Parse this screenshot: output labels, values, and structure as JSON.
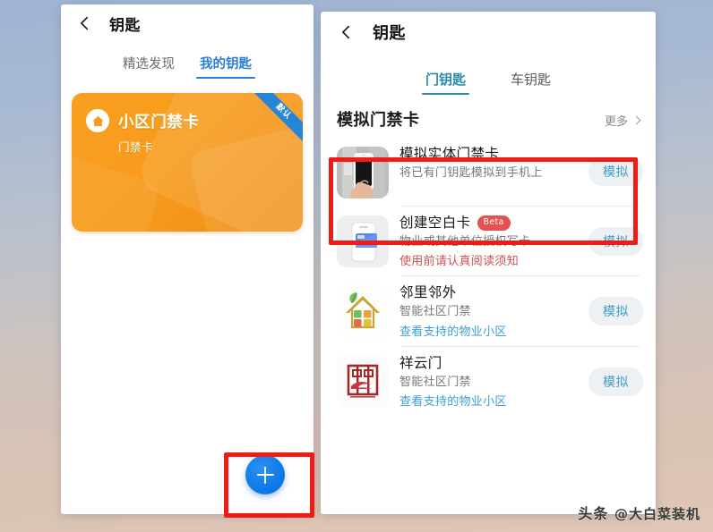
{
  "left_phone": {
    "appbar": {
      "title": "钥匙",
      "back_icon": "back-arrow-icon"
    },
    "tabs": [
      {
        "label": "精选发现",
        "active": false
      },
      {
        "label": "我的钥匙",
        "active": true
      }
    ],
    "card": {
      "title": "小区门禁卡",
      "subtitle": "门禁卡",
      "ribbon_label": "默认",
      "icon": "home-icon",
      "accent": "#f79b1d",
      "ribbon_color": "#2487d6"
    },
    "fab": {
      "icon": "plus-icon",
      "color": "#0d7ae6"
    }
  },
  "right_phone": {
    "appbar": {
      "title": "钥匙",
      "back_icon": "back-arrow-icon"
    },
    "tabs": [
      {
        "label": "门钥匙",
        "active": true
      },
      {
        "label": "车钥匙",
        "active": false
      }
    ],
    "section": {
      "title": "模拟门禁卡",
      "more_label": "更多",
      "more_icon": "chevron-right-icon"
    },
    "items": [
      {
        "thumb": "hand-holding-phone-photo",
        "title": "模拟实体门禁卡",
        "badge": "",
        "desc": "将已有门钥匙模拟到手机上",
        "note": "",
        "note_type": "none",
        "button": "模拟"
      },
      {
        "thumb": "phone-blank-card-icon",
        "title": "创建空白卡",
        "badge": "Beta",
        "desc": "物业或其他单位授权写卡",
        "note": "使用前请认真阅读须知",
        "note_type": "warn",
        "button": "模拟"
      },
      {
        "thumb": "house-leaf-icon",
        "title": "邻里邻外",
        "badge": "",
        "desc": "智能社区门禁",
        "note": "查看支持的物业小区",
        "note_type": "link",
        "button": "模拟"
      },
      {
        "thumb": "gate-seal-icon",
        "title": "祥云门",
        "badge": "",
        "desc": "智能社区门禁",
        "note": "查看支持的物业小区",
        "note_type": "link",
        "button": "模拟"
      }
    ]
  },
  "annotations": {
    "color": "#ee1b17",
    "boxes": [
      {
        "name": "add-key-fab-highlight"
      },
      {
        "name": "simulate-physical-card-highlight"
      }
    ]
  },
  "watermark": {
    "platform": "头条",
    "handle": "@大白菜装机"
  }
}
